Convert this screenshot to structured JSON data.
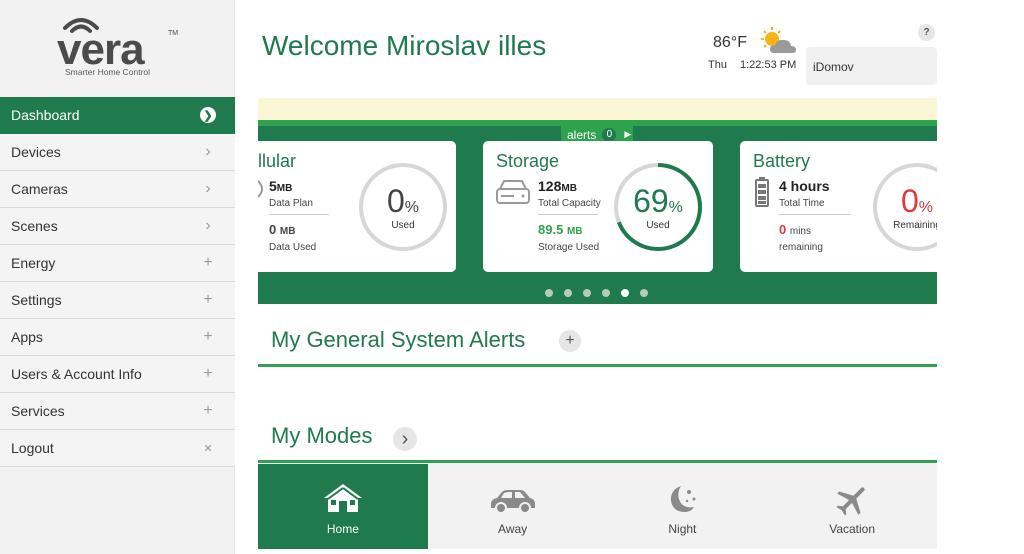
{
  "brand": {
    "word": "vera",
    "tm": "TM",
    "tagline": "Smarter Home Control"
  },
  "sidebar": {
    "items": [
      {
        "label": "Dashboard",
        "icon": "chevron-right-icon",
        "glyph": "❯",
        "active": true
      },
      {
        "label": "Devices",
        "icon": "chevron-right-icon",
        "glyph": "›"
      },
      {
        "label": "Cameras",
        "icon": "chevron-right-icon",
        "glyph": "›"
      },
      {
        "label": "Scenes",
        "icon": "chevron-right-icon",
        "glyph": "›"
      },
      {
        "label": "Energy",
        "icon": "plus-icon",
        "glyph": "+"
      },
      {
        "label": "Settings",
        "icon": "plus-icon",
        "glyph": "+"
      },
      {
        "label": "Apps",
        "icon": "plus-icon",
        "glyph": "+"
      },
      {
        "label": "Users & Account Info",
        "icon": "plus-icon",
        "glyph": "+"
      },
      {
        "label": "Services",
        "icon": "plus-icon",
        "glyph": "+"
      },
      {
        "label": "Logout",
        "icon": "close-icon",
        "glyph": "✕"
      }
    ]
  },
  "header": {
    "welcome": "Welcome Miroslav illes",
    "temperature": "86°F",
    "weather_icon": "partly-cloudy-icon",
    "day": "Thu",
    "time": "1:22:53 PM",
    "user": "iDomov",
    "help": "?"
  },
  "alerts": {
    "label": "alerts",
    "count": "0"
  },
  "cards": {
    "cellular": {
      "title": "Cellular",
      "plan_value": "5",
      "plan_unit": "MB",
      "plan_label": "Data Plan",
      "used_value": "0",
      "used_unit": "MB",
      "used_label": "Data Used",
      "ring_value": "0",
      "ring_unit": "%",
      "ring_label": "Used",
      "ring_fraction": 0
    },
    "storage": {
      "title": "Storage",
      "capacity_value": "128",
      "capacity_unit": "MB",
      "capacity_label": "Total Capacity",
      "used_value": "89.5",
      "used_unit": "MB",
      "used_label": "Storage Used",
      "ring_value": "69",
      "ring_unit": "%",
      "ring_label": "Used",
      "ring_fraction": 0.69
    },
    "battery": {
      "title": "Battery",
      "total_value": "4 hours",
      "total_label": "Total Time",
      "remaining_value": "0",
      "remaining_unit": "mins",
      "remaining_label": "remaining",
      "ring_value": "0",
      "ring_unit": "%",
      "ring_label": "Remaining",
      "ring_fraction": 0
    }
  },
  "carousel": {
    "page_count": 6,
    "active_page": 5
  },
  "sections": {
    "alerts_title": "My General System Alerts",
    "alerts_add": "+",
    "modes_title": "My Modes",
    "modes_arrow": "›"
  },
  "modes": [
    {
      "label": "Home",
      "icon": "house-icon",
      "active": true
    },
    {
      "label": "Away",
      "icon": "car-icon"
    },
    {
      "label": "Night",
      "icon": "moon-stars-icon"
    },
    {
      "label": "Vacation",
      "icon": "airplane-icon"
    }
  ],
  "colors": {
    "brand_green": "#1f7a4d",
    "accent_green": "#2fa24e",
    "alert_red": "#e0393e",
    "banner_yellow": "#fbf6d6"
  }
}
